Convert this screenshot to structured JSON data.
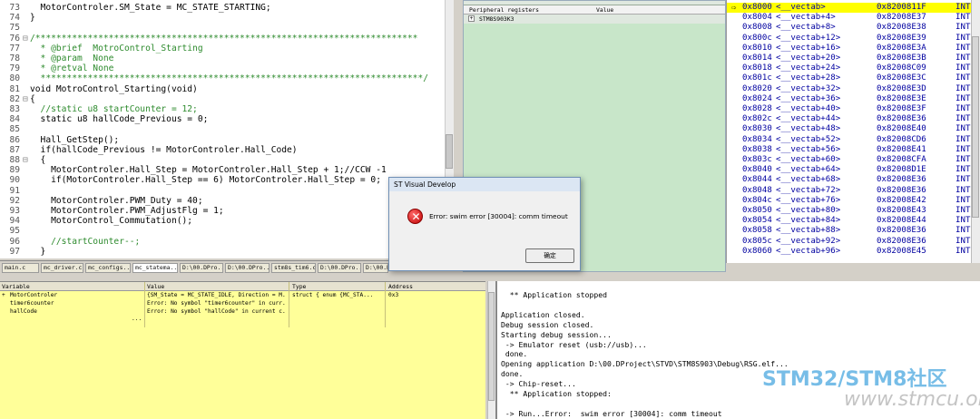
{
  "editor": {
    "lines": [
      {
        "no": "73",
        "gutter": "",
        "text": "  MotorControler.SM_State = MC_STATE_STARTING;",
        "style": "normal"
      },
      {
        "no": "74",
        "gutter": "",
        "text": "}",
        "style": "normal"
      },
      {
        "no": "75",
        "gutter": "",
        "text": "",
        "style": "normal"
      },
      {
        "no": "76",
        "gutter": "⊟",
        "text": "/*************************************************************************",
        "style": "comment"
      },
      {
        "no": "77",
        "gutter": "",
        "text": "  * @brief  MotroControl_Starting",
        "style": "comment"
      },
      {
        "no": "78",
        "gutter": "",
        "text": "  * @param  None",
        "style": "comment"
      },
      {
        "no": "79",
        "gutter": "",
        "text": "  * @retval None",
        "style": "comment"
      },
      {
        "no": "80",
        "gutter": "",
        "text": "  *************************************************************************/",
        "style": "comment"
      },
      {
        "no": "81",
        "gutter": "",
        "text": "void MotroControl_Starting(void)",
        "style": "normal"
      },
      {
        "no": "82",
        "gutter": "⊟",
        "text": "{",
        "style": "normal"
      },
      {
        "no": "83",
        "gutter": "",
        "text": "  //static u8 startCounter = 12;",
        "style": "comment"
      },
      {
        "no": "84",
        "gutter": "",
        "text": "  static u8 hallCode_Previous = 0;",
        "style": "normal"
      },
      {
        "no": "85",
        "gutter": "",
        "text": "",
        "style": "normal"
      },
      {
        "no": "86",
        "gutter": "",
        "text": "  Hall_GetStep();",
        "style": "normal"
      },
      {
        "no": "87",
        "gutter": "",
        "text": "  if(hallCode_Previous != MotorControler.Hall_Code)",
        "style": "normal"
      },
      {
        "no": "88",
        "gutter": "⊟",
        "text": "  {",
        "style": "normal"
      },
      {
        "no": "89",
        "gutter": "",
        "text": "    MotorControler.Hall_Step = MotorControler.Hall_Step + 1;//CCW -1",
        "style": "normal"
      },
      {
        "no": "90",
        "gutter": "",
        "text": "    if(MotorControler.Hall_Step == 6) MotorControler.Hall_Step = 0;",
        "style": "normal"
      },
      {
        "no": "91",
        "gutter": "",
        "text": "",
        "style": "normal"
      },
      {
        "no": "92",
        "gutter": "",
        "text": "    MotorControler.PWM_Duty = 40;",
        "style": "normal"
      },
      {
        "no": "93",
        "gutter": "",
        "text": "    MotorControler.PWM_AdjustFlg = 1;",
        "style": "normal"
      },
      {
        "no": "94",
        "gutter": "",
        "text": "    MotorControl_Commutation();",
        "style": "normal"
      },
      {
        "no": "95",
        "gutter": "",
        "text": "",
        "style": "normal"
      },
      {
        "no": "96",
        "gutter": "",
        "text": "    //startCounter--;",
        "style": "comment"
      },
      {
        "no": "97",
        "gutter": "",
        "text": "  }",
        "style": "normal"
      }
    ]
  },
  "file_tabs": [
    {
      "label": "main.c",
      "active": false
    },
    {
      "label": "mc_driver.c",
      "active": false
    },
    {
      "label": "mc_configs...",
      "active": false
    },
    {
      "label": "mc_statema...",
      "active": true
    },
    {
      "label": "D:\\00.DPro...",
      "active": false
    },
    {
      "label": "D:\\00.DPro...",
      "active": false
    },
    {
      "label": "stm8s_tim6.c",
      "active": false
    },
    {
      "label": "D:\\00.DPro...",
      "active": false
    },
    {
      "label": "D:\\00.D",
      "active": false
    }
  ],
  "peripheral": {
    "col_name": "Peripheral registers",
    "col_value": "Value",
    "row_expander": "+",
    "row_name": "STM8S903K3",
    "row_value": ""
  },
  "disasm": {
    "rows": [
      {
        "addr": "0x8000",
        "label": "<__vectab>",
        "value": "0x8200811F",
        "type": "INT"
      },
      {
        "addr": "0x8004",
        "label": "<__vectab+4>",
        "value": "0x82008E37",
        "type": "INT"
      },
      {
        "addr": "0x8008",
        "label": "<__vectab+8>",
        "value": "0x82008E38",
        "type": "INT"
      },
      {
        "addr": "0x800c",
        "label": "<__vectab+12>",
        "value": "0x82008E39",
        "type": "INT"
      },
      {
        "addr": "0x8010",
        "label": "<__vectab+16>",
        "value": "0x82008E3A",
        "type": "INT"
      },
      {
        "addr": "0x8014",
        "label": "<__vectab+20>",
        "value": "0x82008E3B",
        "type": "INT"
      },
      {
        "addr": "0x8018",
        "label": "<__vectab+24>",
        "value": "0x82008C09",
        "type": "INT"
      },
      {
        "addr": "0x801c",
        "label": "<__vectab+28>",
        "value": "0x82008E3C",
        "type": "INT"
      },
      {
        "addr": "0x8020",
        "label": "<__vectab+32>",
        "value": "0x82008E3D",
        "type": "INT"
      },
      {
        "addr": "0x8024",
        "label": "<__vectab+36>",
        "value": "0x82008E3E",
        "type": "INT"
      },
      {
        "addr": "0x8028",
        "label": "<__vectab+40>",
        "value": "0x82008E3F",
        "type": "INT"
      },
      {
        "addr": "0x802c",
        "label": "<__vectab+44>",
        "value": "0x82008E36",
        "type": "INT"
      },
      {
        "addr": "0x8030",
        "label": "<__vectab+48>",
        "value": "0x82008E40",
        "type": "INT"
      },
      {
        "addr": "0x8034",
        "label": "<__vectab+52>",
        "value": "0x82008CD6",
        "type": "INT"
      },
      {
        "addr": "0x8038",
        "label": "<__vectab+56>",
        "value": "0x82008E41",
        "type": "INT"
      },
      {
        "addr": "0x803c",
        "label": "<__vectab+60>",
        "value": "0x82008CFA",
        "type": "INT"
      },
      {
        "addr": "0x8040",
        "label": "<__vectab+64>",
        "value": "0x82008D1E",
        "type": "INT"
      },
      {
        "addr": "0x8044",
        "label": "<__vectab+68>",
        "value": "0x82008E36",
        "type": "INT"
      },
      {
        "addr": "0x8048",
        "label": "<__vectab+72>",
        "value": "0x82008E36",
        "type": "INT"
      },
      {
        "addr": "0x804c",
        "label": "<__vectab+76>",
        "value": "0x82008E42",
        "type": "INT"
      },
      {
        "addr": "0x8050",
        "label": "<__vectab+80>",
        "value": "0x82008E43",
        "type": "INT"
      },
      {
        "addr": "0x8054",
        "label": "<__vectab+84>",
        "value": "0x82008E44",
        "type": "INT"
      },
      {
        "addr": "0x8058",
        "label": "<__vectab+88>",
        "value": "0x82008E36",
        "type": "INT"
      },
      {
        "addr": "0x805c",
        "label": "<__vectab+92>",
        "value": "0x82008E36",
        "type": "INT"
      },
      {
        "addr": "0x8060",
        "label": "<__vectab+96>",
        "value": "0x82008E45",
        "type": "INT"
      }
    ]
  },
  "variables": {
    "headers": {
      "name": "Variable",
      "value": "Value",
      "type": "Type",
      "address": "Address"
    },
    "rows": [
      {
        "expander": "+",
        "name": "MotorControler",
        "value": "{SM_State = MC_STATE_IDLE, Direction = M...",
        "type": "struct {   enum {MC_STA...",
        "address": "0x3"
      },
      {
        "expander": "",
        "name": "timer6counter",
        "value": "Error: No symbol \"timer6counter\" in curr...",
        "type": "",
        "address": ""
      },
      {
        "expander": "",
        "name": "hallCode",
        "value": "Error: No symbol \"hallCode\" in current c...",
        "type": "",
        "address": ""
      },
      {
        "expander": "",
        "name": "",
        "value": "...",
        "type": "",
        "address": ""
      }
    ]
  },
  "output": {
    "lines": [
      "  ** Application stopped",
      "",
      "Application closed.",
      "Debug session closed.",
      "Starting debug session...",
      " -> Emulator reset (usb://usb)...",
      " done.",
      "Opening application D:\\00.DProject\\STVD\\STM8S903\\Debug\\RSG.elf...",
      "done.",
      " -> Chip-reset...",
      "  ** Application stopped:",
      "",
      " -> Run...Error:  swim error [30004]: comm timeout"
    ]
  },
  "dialog": {
    "title": "ST Visual Develop",
    "message": "Error:  swim error [30004]: comm timeout",
    "ok_label": "确定",
    "icon": "error-icon"
  },
  "watermark": {
    "logo": "STM32/STM8社区",
    "url": "www.stmcu.org"
  }
}
